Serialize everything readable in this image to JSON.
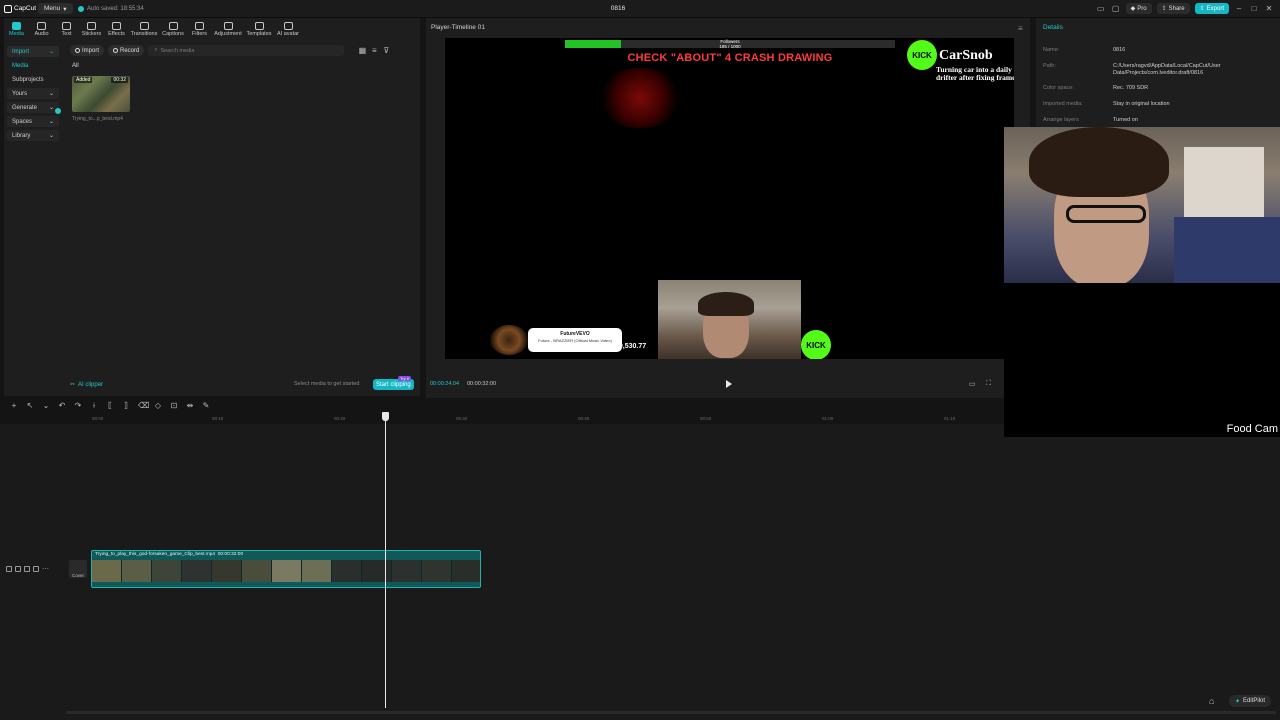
{
  "app": {
    "title": "0816",
    "logo": "CapCut",
    "menu_label": "Menu",
    "autosave": "Auto saved: 18:55:34"
  },
  "header_right": {
    "pro": "Pro",
    "share": "Share",
    "export": "Export"
  },
  "toolbar": {
    "items": [
      "Media",
      "Audio",
      "Text",
      "Stickers",
      "Effects",
      "Transitions",
      "Captions",
      "Filters",
      "Adjustment",
      "Templates",
      "AI avatar"
    ]
  },
  "sidenav": {
    "items": [
      {
        "label": "Import"
      },
      {
        "label": "Media"
      },
      {
        "label": "Subprojects"
      },
      {
        "label": "Yours"
      },
      {
        "label": "Generate"
      },
      {
        "label": "Spaces"
      },
      {
        "label": "Library"
      }
    ]
  },
  "media": {
    "import_label": "Import",
    "record_label": "Record",
    "search_placeholder": "Search media",
    "filter": "All",
    "thumb_added": "Added",
    "thumb_duration": "00:32",
    "thumb_name": "Trying_to...p_best.mp4",
    "ai_clipper": "AI clipper",
    "hint": "Select media to get started",
    "start_clipping": "Start clipping",
    "try_badge": "Try it"
  },
  "player": {
    "title": "Player-Timeline 01",
    "progress_label": "Followers\n185 / 1000",
    "progress_fraction": 0.17,
    "headline": "CHECK \"ABOUT\" 4 CRASH DRAWING",
    "brand": "CarSnob",
    "brand_sub": "Turning car into a daily drifter after fixing frame",
    "kick": "KICK",
    "card_title": "FutureVEVO",
    "card_sub": "Future - BRAZZIER (Official Music Video)",
    "stock_value": "99,530.77",
    "time_current": "00:00:24:04",
    "time_total": "00:00:32:00"
  },
  "details": {
    "title": "Details",
    "rows": [
      {
        "label": "Name:",
        "value": "0816"
      },
      {
        "label": "Path:",
        "value": "C:/Users/ragvd/AppData/Local/CapCut/User Data/Projects/com.lveditor.draft/0816"
      },
      {
        "label": "Color space:",
        "value": "Rec. 709 SDR"
      },
      {
        "label": "Imported media:",
        "value": "Stay in original location"
      },
      {
        "label": "Arrange layers",
        "value": "Turned on"
      }
    ]
  },
  "webcam": {
    "label": "Food Cam"
  },
  "timeline": {
    "ruler": [
      "00:00",
      "00:10",
      "00:20",
      "00:30",
      "00:40",
      "00:50",
      "01:00",
      "01:10"
    ],
    "clip_name": "Trying_to_play_this_god-forsaken_game_Clip_best.mp4",
    "clip_duration": "00:00:32:00",
    "cover": "Cover"
  },
  "editpilot": "EditPilot"
}
